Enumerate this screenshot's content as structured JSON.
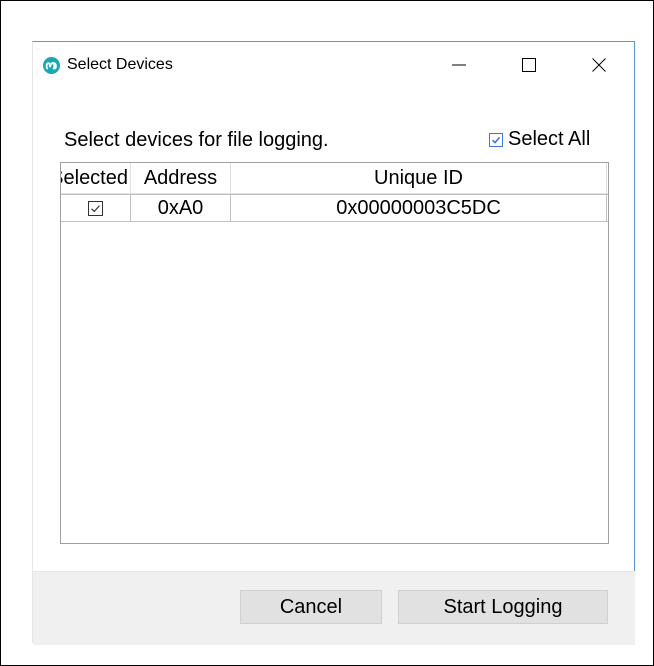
{
  "window": {
    "title": "Select Devices",
    "app_icon": "maxim-logo-icon",
    "controls": [
      "minimize-icon",
      "maximize-icon",
      "close-icon"
    ]
  },
  "main": {
    "instruction": "Select devices for file logging.",
    "select_all": {
      "label": "Select All",
      "checked": true
    }
  },
  "table": {
    "columns": [
      "Selected",
      "Address",
      "Unique ID"
    ],
    "rows": [
      {
        "selected": true,
        "address": "0xA0",
        "unique_id": "0x00000003C5DC"
      }
    ]
  },
  "footer": {
    "cancel_label": "Cancel",
    "start_label": "Start Logging"
  },
  "colors": {
    "accent": "#3c78d8",
    "window_border": "#5b9bd5",
    "footer_bg": "#f0f0f0",
    "button_bg": "#e1e1e1",
    "icon_teal": "#1aa7b4"
  }
}
